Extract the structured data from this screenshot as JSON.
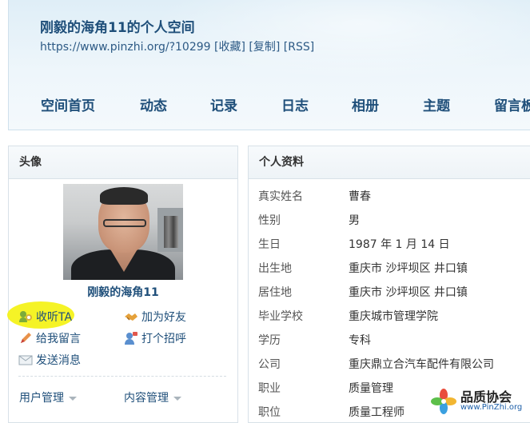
{
  "header": {
    "title": "刚毅的海角11的个人空间",
    "url": "https://www.pinzhi.org/?10299",
    "links": [
      "[收藏]",
      "[复制]",
      "[RSS]"
    ]
  },
  "nav": [
    "空间首页",
    "动态",
    "记录",
    "日志",
    "相册",
    "主题",
    "留言板"
  ],
  "left_panel": {
    "title": "头像",
    "username": "刚毅的海角11",
    "actions": {
      "follow": "收听TA",
      "add_friend": "加为好友",
      "leave_message": "给我留言",
      "greet": "打个招呼",
      "send_message": "发送消息"
    },
    "menus": [
      "用户管理",
      "内容管理"
    ]
  },
  "right_panel": {
    "title": "个人资料",
    "rows": [
      {
        "label": "真实姓名",
        "value": "曹春"
      },
      {
        "label": "性别",
        "value": "男"
      },
      {
        "label": "生日",
        "value": "1987 年 1 月 14 日"
      },
      {
        "label": "出生地",
        "value": "重庆市 沙坪坝区 井口镇"
      },
      {
        "label": "居住地",
        "value": "重庆市 沙坪坝区 井口镇"
      },
      {
        "label": "毕业学校",
        "value": "重庆城市管理学院"
      },
      {
        "label": "学历",
        "value": "专科"
      },
      {
        "label": "公司",
        "value": "重庆鼎立合汽车配件有限公司"
      },
      {
        "label": "职业",
        "value": "质量管理"
      },
      {
        "label": "职位",
        "value": "质量工程师"
      }
    ]
  },
  "watermark": {
    "name": "品质协会",
    "url": "www.PinZhi.org"
  },
  "colors": {
    "link": "#1f4f7a",
    "highlight": "#f4f21a"
  }
}
